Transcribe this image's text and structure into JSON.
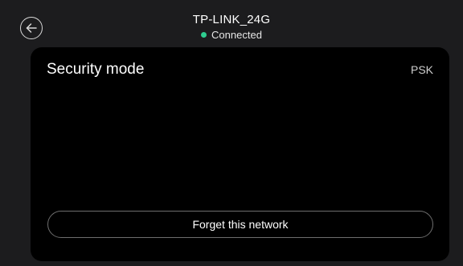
{
  "header": {
    "network_name": "TP-LINK_24G",
    "status": "Connected",
    "status_color": "#2ecc8f"
  },
  "icons": {
    "back": "arrow-left-icon",
    "status": "status-dot-icon"
  },
  "security": {
    "label": "Security mode",
    "value": "PSK"
  },
  "actions": {
    "forget_label": "Forget this network"
  },
  "colors": {
    "background": "#1c1c1e",
    "panel": "#000000",
    "text": "#ffffff",
    "button_border": "#6e6e6e"
  }
}
